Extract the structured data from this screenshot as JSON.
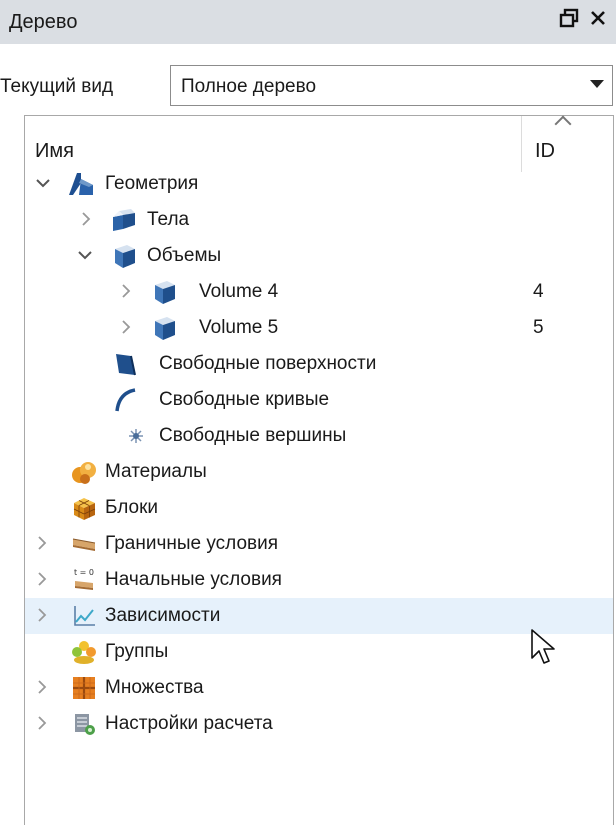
{
  "panel": {
    "title": "Дерево",
    "float_icon": "float-window-icon",
    "close_icon": "close-icon"
  },
  "view": {
    "label": "Текущий вид",
    "selected": "Полное дерево"
  },
  "columns": {
    "name": "Имя",
    "id": "ID"
  },
  "rows": [
    {
      "label": "Геометрия",
      "id": "",
      "icon": "geometry-icon",
      "expander": "expanded"
    },
    {
      "label": "Тела",
      "id": "",
      "icon": "bodies-cube-icon",
      "expander": "collapsed"
    },
    {
      "label": "Объемы",
      "id": "",
      "icon": "volume-cube-icon",
      "expander": "expanded"
    },
    {
      "label": "Volume 4",
      "id": "4",
      "icon": "volume-cube-icon",
      "expander": "collapsed"
    },
    {
      "label": "Volume 5",
      "id": "5",
      "icon": "volume-cube-icon",
      "expander": "collapsed"
    },
    {
      "label": "Свободные поверхности",
      "id": "",
      "icon": "surface-icon",
      "expander": "none"
    },
    {
      "label": "Свободные кривые",
      "id": "",
      "icon": "curve-icon",
      "expander": "none"
    },
    {
      "label": "Свободные вершины",
      "id": "",
      "icon": "vertex-icon",
      "expander": "none"
    },
    {
      "label": "Материалы",
      "id": "",
      "icon": "materials-icon",
      "expander": "none"
    },
    {
      "label": "Блоки",
      "id": "",
      "icon": "blocks-icon",
      "expander": "none"
    },
    {
      "label": "Граничные условия",
      "id": "",
      "icon": "boundary-conditions-icon",
      "expander": "collapsed"
    },
    {
      "label": "Начальные условия",
      "id": "",
      "icon": "initial-conditions-icon",
      "expander": "collapsed"
    },
    {
      "label": "Зависимости",
      "id": "",
      "icon": "dependencies-chart-icon",
      "expander": "collapsed"
    },
    {
      "label": "Группы",
      "id": "",
      "icon": "groups-icon",
      "expander": "none"
    },
    {
      "label": "Множества",
      "id": "",
      "icon": "sets-icon",
      "expander": "collapsed"
    },
    {
      "label": "Настройки расчета",
      "id": "",
      "icon": "calc-settings-icon",
      "expander": "collapsed"
    }
  ],
  "initial_conditions_icon_text": "t = 0",
  "hovered_row": "Зависимости",
  "colors": {
    "titlebar": "#dadee3",
    "hover": "#e6f1fb",
    "cube": "#1f4f8c",
    "cube_light": "#d6e2f0",
    "accent_orange": "#e8951f"
  }
}
